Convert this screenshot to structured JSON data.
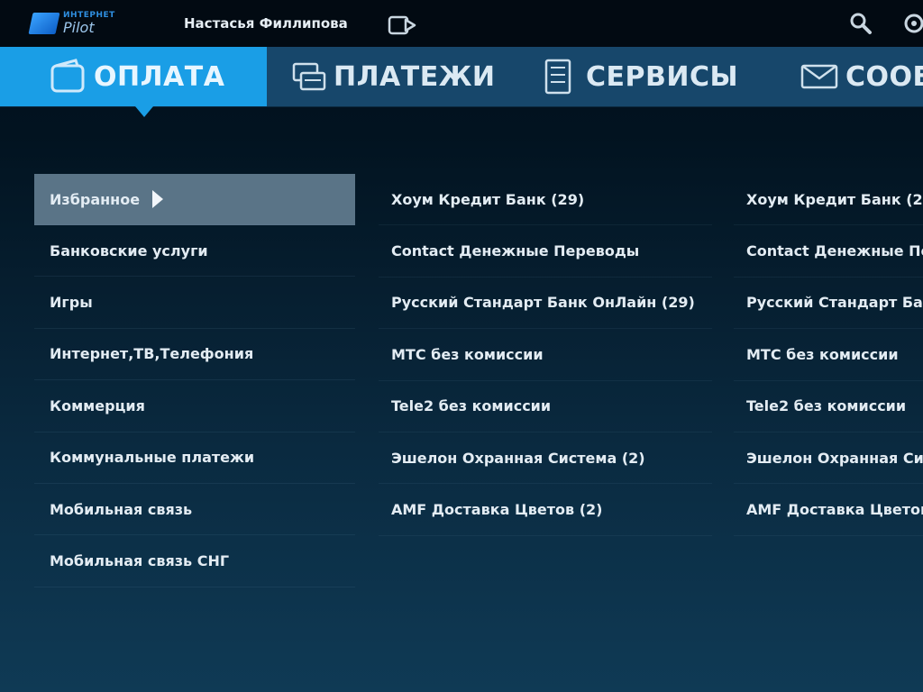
{
  "header": {
    "logo_small": "ИНТЕРНЕТ",
    "logo_text": "Pilot",
    "username": "Настасья Филлипова",
    "icons": [
      "logout-icon",
      "search-icon",
      "settings-icon"
    ]
  },
  "tabs": [
    {
      "label": "ОПЛАТА",
      "icon": "wallet-icon",
      "active": true
    },
    {
      "label": "ПЛАТЕЖИ",
      "icon": "payments-icon",
      "active": false
    },
    {
      "label": "СЕРВИСЫ",
      "icon": "services-icon",
      "active": false
    },
    {
      "label": "СООБЩЕНИЯ",
      "icon": "envelope-icon",
      "active": false
    }
  ],
  "categories": [
    "Избранное",
    "Банковские услуги",
    "Игры",
    "Интернет,ТВ,Телефония",
    "Коммерция",
    "Коммунальные платежи",
    "Мобильная связь",
    "Мобильная связь СНГ"
  ],
  "selected_category": "Избранное",
  "favorites": [
    "Хоум Кредит Банк (29)",
    "Contact Денежные Переводы",
    "Русский Стандарт Банк ОнЛайн (29)",
    "МТС без комиссии",
    "Tele2 без комиссии",
    "Эшелон Охранная Система (2)",
    "AMF Доставка Цветов (2)"
  ],
  "colors": {
    "accent": "#1a9ee6",
    "tabbar": "#17476b",
    "topbar": "#020a12",
    "selected_row": "#5a7487"
  }
}
